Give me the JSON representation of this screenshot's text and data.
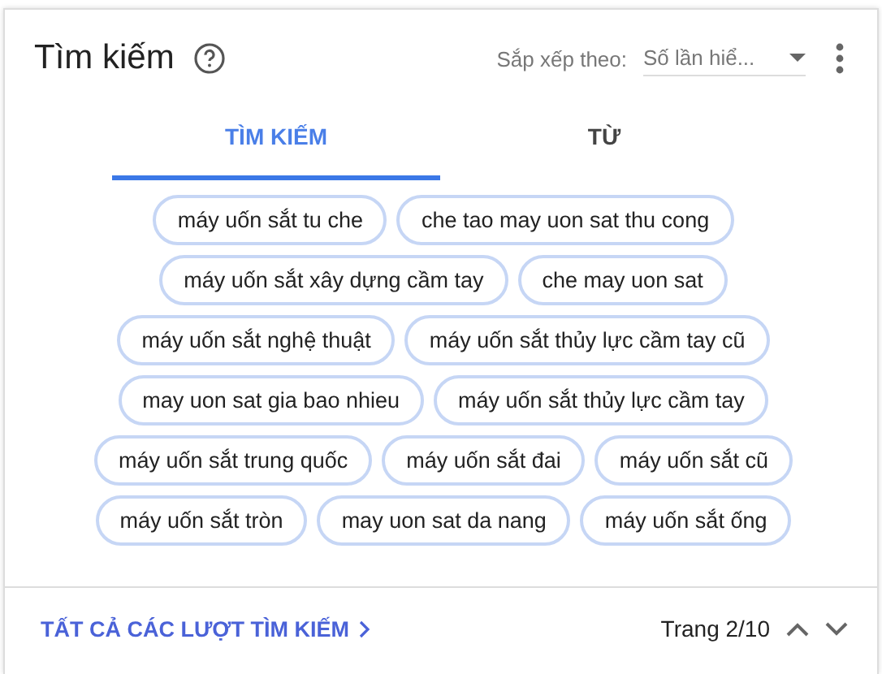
{
  "header": {
    "title": "Tìm kiếm",
    "sort_label": "Sắp xếp theo:",
    "sort_value": "Số lần hiể..."
  },
  "tabs": [
    {
      "label": "TÌM KIẾM",
      "selected": true
    },
    {
      "label": "TỪ",
      "selected": false
    }
  ],
  "chip_rows": [
    [
      "máy uốn sắt tu che",
      "che tao may uon sat thu cong"
    ],
    [
      "máy uốn sắt xây dựng cầm tay",
      "che may uon sat"
    ],
    [
      "máy uốn sắt nghệ thuật",
      "máy uốn sắt thủy lực cầm tay cũ"
    ],
    [
      "may uon sat gia bao nhieu",
      "máy uốn sắt thủy lực cầm tay"
    ],
    [
      "máy uốn sắt trung quốc",
      "máy uốn sắt đai",
      "máy uốn sắt cũ"
    ],
    [
      "máy uốn sắt tròn",
      "may uon sat da nang",
      "máy uốn sắt ống"
    ]
  ],
  "footer": {
    "link": "TẤT CẢ CÁC LƯỢT TÌM KIẾM",
    "page": "Trang 2/10"
  }
}
